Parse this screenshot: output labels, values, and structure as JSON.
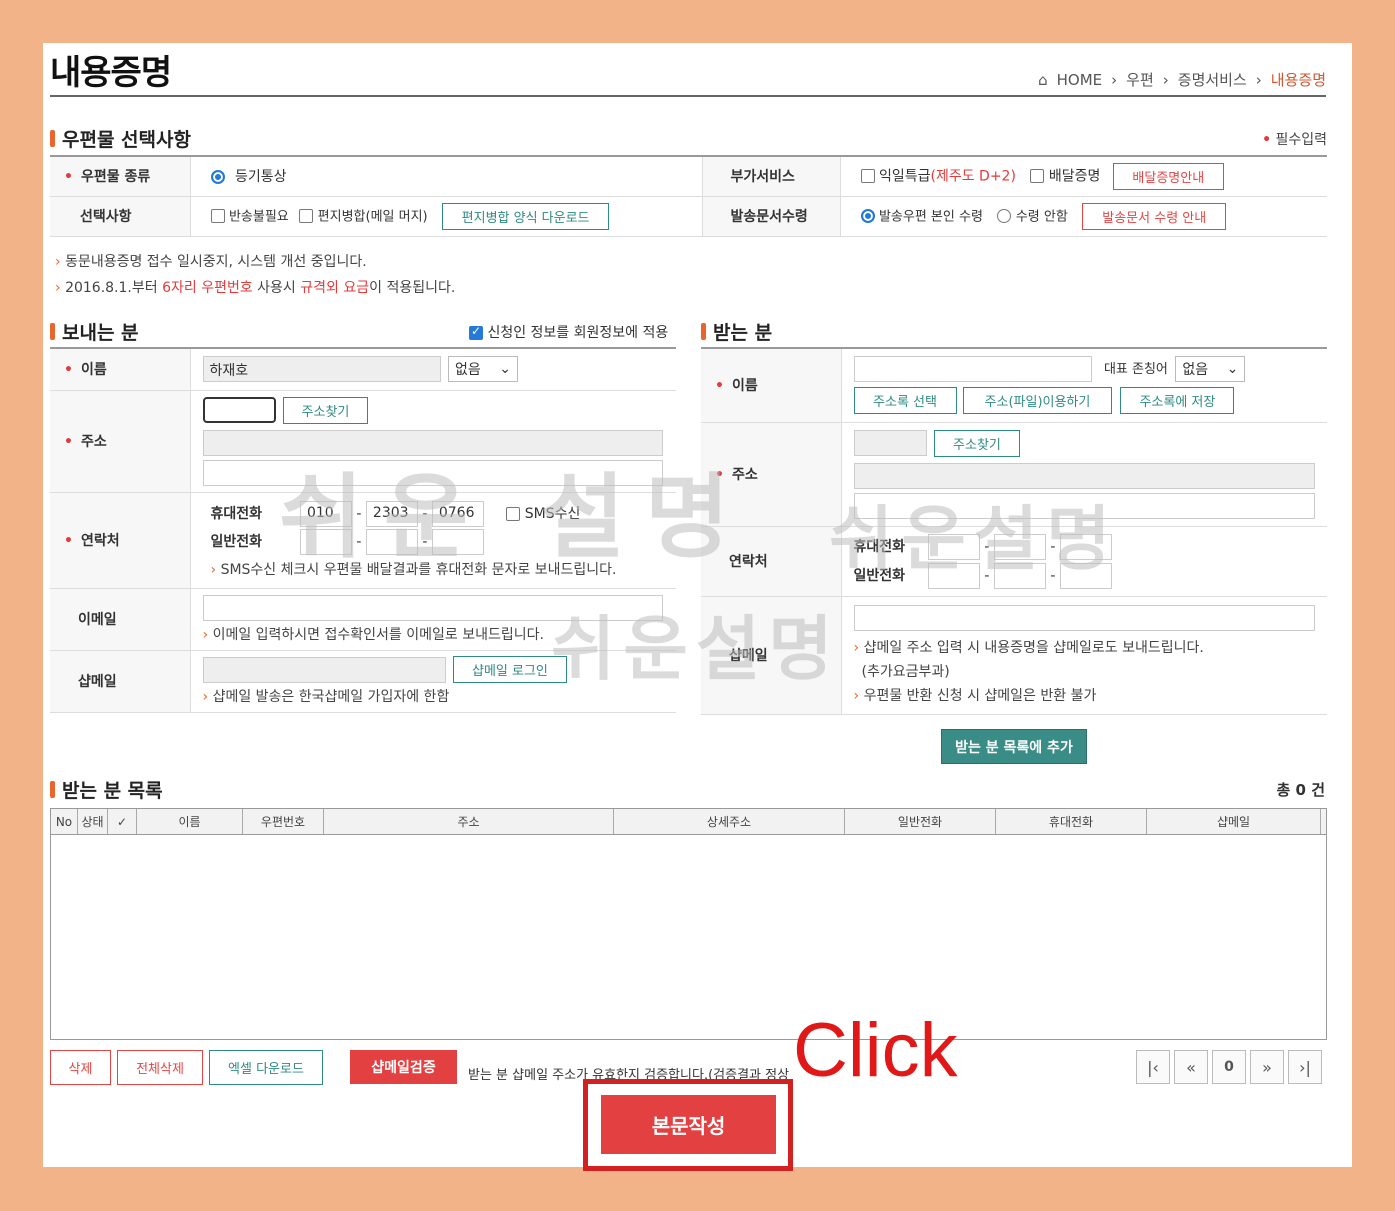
{
  "page": {
    "title": "내용증명",
    "breadcrumb": [
      "HOME",
      "우편",
      "증명서비스",
      "내용증명"
    ],
    "required_note": "필수입력"
  },
  "mail_options": {
    "section_title": "우편물 선택사항",
    "type_label": "우편물 종류",
    "type_value": "등기통상",
    "extra_label": "부가서비스",
    "extra_option1": "익일특급",
    "extra_option1_note": "(제주도 D+2)",
    "extra_option2": "배달증명",
    "extra_guide_btn": "배달증명안내",
    "select_label": "선택사항",
    "opt_return": "반송불필요",
    "opt_merge": "편지병합(메일 머지)",
    "merge_download_btn": "편지병합 양식 다운로드",
    "doc_receive_label": "발송문서수령",
    "doc_receive_opt1": "발송우편 본인 수령",
    "doc_receive_opt2": "수령 안함",
    "doc_receive_guide_btn": "발송문서 수령 안내"
  },
  "notices": {
    "line1": "동문내용증명 접수 일시중지, 시스템 개선 중입니다.",
    "line2_a": "2016.8.1.부터 ",
    "line2_b": "6자리 우편번호",
    "line2_c": " 사용시 ",
    "line2_d": "규격외 요금",
    "line2_e": "이 적용됩니다."
  },
  "sender": {
    "section_title": "보내는 분",
    "apply_member": "신청인 정보를 회원정보에 적용",
    "name_label": "이름",
    "name_value": "하재호",
    "title_select": "없음",
    "addr_label": "주소",
    "addr_find_btn": "주소찾기",
    "contact_label": "연락처",
    "mobile_label": "휴대전화",
    "mobile1": "010",
    "mobile2": "2303",
    "mobile3": "0766",
    "sms_label": "SMS수신",
    "phone_label": "일반전화",
    "sms_note": "SMS수신 체크시 우편물 배달결과를 휴대전화 문자로 보내드립니다.",
    "email_label": "이메일",
    "email_note": "이메일 입력하시면 접수확인서를 이메일로 보내드립니다.",
    "shopmail_label": "샵메일",
    "shopmail_login_btn": "샵메일 로그인",
    "shopmail_note": "샵메일 발송은 한국샵메일 가입자에 한함"
  },
  "receiver": {
    "section_title": "받는 분",
    "name_label": "이름",
    "honorific_label": "대표 존칭어",
    "honorific_select": "없음",
    "addrbook_btn": "주소록 선택",
    "addrfile_btn": "주소(파일)이용하기",
    "addrsave_btn": "주소록에 저장",
    "addr_label": "주소",
    "addr_find_btn": "주소찾기",
    "contact_label": "연락처",
    "mobile_label": "휴대전화",
    "phone_label": "일반전화",
    "shopmail_label": "샵메일",
    "shopmail_note1": "샵메일 주소 입력 시 내용증명을 샵메일로도 보내드립니다.",
    "shopmail_note1b": "(추가요금부과)",
    "shopmail_note2": "우편물 반환 신청 시 샵메일은 반환 불가",
    "add_btn": "받는 분 목록에 추가"
  },
  "list": {
    "section_title": "받는 분 목록",
    "total": "총 0 건",
    "columns": [
      "No",
      "상태",
      "✓",
      "이름",
      "우편번호",
      "주소",
      "상세주소",
      "일반전화",
      "휴대전화",
      "샵메일"
    ]
  },
  "actions": {
    "delete": "삭제",
    "delete_all": "전체삭제",
    "excel": "엑셀 다운로드",
    "verify": "샵메일검증",
    "verify_note": "받는 분 샵메일 주소가 유효한지 검증합니다.(검증결과 정상",
    "write": "본문작성",
    "page_num": "0"
  },
  "overlay": {
    "click_label": "Click",
    "watermark": "쉬운설명",
    "watermark_spaced": "쉬운 설명"
  }
}
